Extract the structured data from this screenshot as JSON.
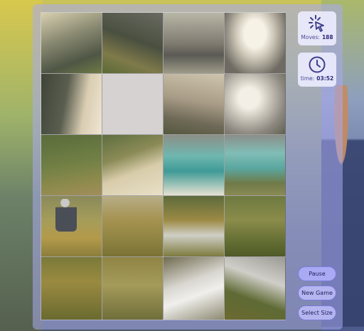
{
  "game": {
    "moves_label": "Moves:",
    "moves_value": "188",
    "time_label": "time:",
    "time_value": "03:52"
  },
  "buttons": {
    "pause": "Pause",
    "new_game": "New Game",
    "select_size": "Select Size"
  },
  "icons": {
    "moves": "cursor-click-icon",
    "time": "clock-icon"
  },
  "colors": {
    "panel": "#aaaaf0",
    "accent": "#a9a9f4",
    "text": "#4a4a9a",
    "empty_tile": "#d6d2d2"
  },
  "puzzle": {
    "grid": "4x5",
    "empty_tile": {
      "row": 2,
      "col": 2
    }
  }
}
